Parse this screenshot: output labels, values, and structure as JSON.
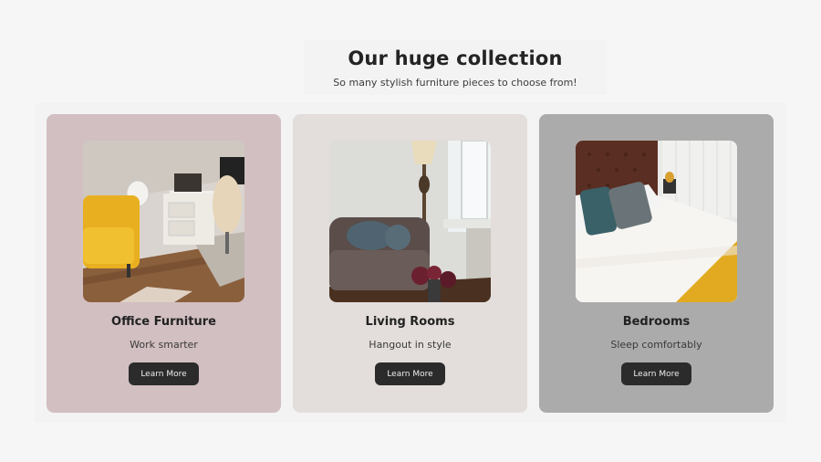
{
  "header": {
    "title": "Our huge collection",
    "subtitle": "So many stylish furniture pieces to choose from!"
  },
  "cards": [
    {
      "title": "Office Furniture",
      "subtitle": "Work smarter",
      "button_label": "Learn More",
      "background": "#d2bfc2"
    },
    {
      "title": "Living Rooms",
      "subtitle": "Hangout in style",
      "button_label": "Learn More",
      "background": "#e3dedb"
    },
    {
      "title": "Bedrooms",
      "subtitle": "Sleep comfortably",
      "button_label": "Learn More",
      "background": "#ababab"
    }
  ],
  "colors": {
    "page_bg": "#f6f6f6",
    "button_bg": "#2b2b2b",
    "button_text": "#eeeeee"
  }
}
